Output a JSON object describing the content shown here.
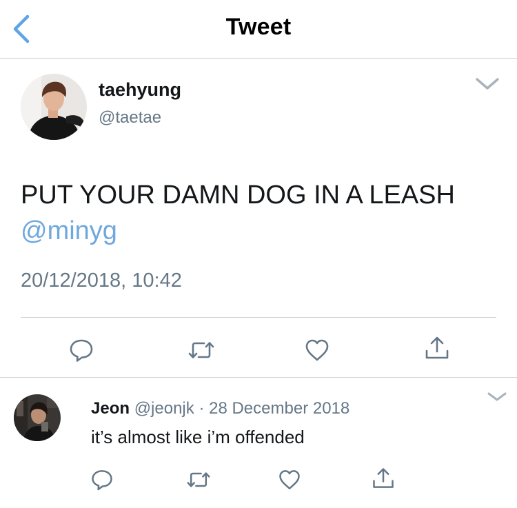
{
  "nav": {
    "title": "Tweet"
  },
  "tweet": {
    "author_name": "taehyung",
    "author_handle": "@taetae",
    "text": "PUT YOUR DAMN DOG IN A LEASH",
    "mention": "@minyg",
    "timestamp": "20/12/2018, 10:42"
  },
  "reply": {
    "author_name": "Jeon",
    "author_handle": "@jeonjk",
    "separator": "·",
    "date": "28 December 2018",
    "text": "it’s almost like i’m offended"
  },
  "icons": {
    "back": "chevron-left-icon",
    "more": "chevron-down-icon",
    "reply": "reply-icon",
    "retweet": "retweet-icon",
    "like": "heart-icon",
    "share": "share-icon"
  },
  "colors": {
    "accent": "#1da1f2",
    "back_arrow": "#5ea5e8",
    "mention": "#6ea8dc",
    "secondary_text": "#657786",
    "icon_gray": "#657786",
    "divider": "#cfd4d8"
  }
}
